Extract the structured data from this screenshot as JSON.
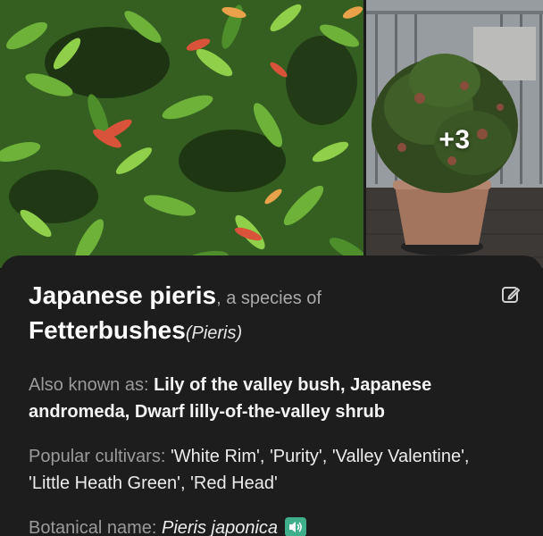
{
  "gallery": {
    "more_count": "+3"
  },
  "plant": {
    "common_name": "Japanese pieris",
    "species_of": ", a species of",
    "genus_name": "Fetterbushes",
    "genus_latin": "(Pieris)"
  },
  "also_known_as": {
    "label": "Also known as: ",
    "value": "Lily of the valley bush, Japanese andromeda, Dwarf lilly-of-the-valley shrub"
  },
  "cultivars": {
    "label": "Popular cultivars: ",
    "value": "'White Rim', 'Purity', 'Valley Valentine', 'Little Heath Green', 'Red Head'"
  },
  "botanical": {
    "label": "Botanical name: ",
    "value": "Pieris japonica"
  },
  "icons": {
    "edit": "edit-icon",
    "speaker": "speaker-icon"
  },
  "colors": {
    "card_background": "#1d1d1d",
    "speaker_accent": "#3fae8a",
    "foliage_green": "#4e8f2c",
    "new_growth_red": "#d9533a"
  }
}
